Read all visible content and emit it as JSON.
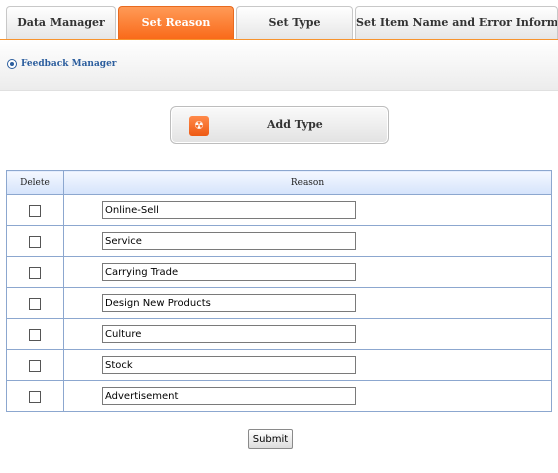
{
  "tabs": [
    {
      "label": "Data Manager",
      "active": false
    },
    {
      "label": "Set Reason",
      "active": true
    },
    {
      "label": "Set Type",
      "active": false
    },
    {
      "label": "Set Item Name and Error Information",
      "active": false
    }
  ],
  "breadcrumb": {
    "label": "Feedback Manager",
    "icon": "radio-bullet-icon"
  },
  "add_type": {
    "label": "Add Type",
    "icon": "add-type-icon"
  },
  "table": {
    "headers": {
      "delete": "Delete",
      "reason": "Reason"
    },
    "rows": [
      {
        "checked": false,
        "value": "Online-Sell"
      },
      {
        "checked": false,
        "value": "Service"
      },
      {
        "checked": false,
        "value": "Carrying Trade"
      },
      {
        "checked": false,
        "value": "Design New Products"
      },
      {
        "checked": false,
        "value": "Culture"
      },
      {
        "checked": false,
        "value": "Stock"
      },
      {
        "checked": false,
        "value": "Advertisement"
      }
    ]
  },
  "submit": {
    "label": "Submit"
  },
  "colors": {
    "accent": "#f7932d",
    "link": "#2c5e9e",
    "table_border": "#8ca7cf"
  }
}
